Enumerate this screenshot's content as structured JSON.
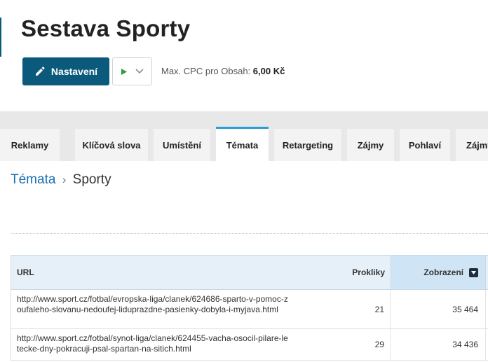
{
  "header": {
    "title": "Sestava Sporty",
    "settings_label": "Nastavení",
    "cpc_label": "Max. CPC pro Obsah:",
    "cpc_value": "6,00 Kč"
  },
  "tabs": [
    {
      "label": "Reklamy",
      "active": false
    },
    {
      "label": "Klíčová slova",
      "active": false
    },
    {
      "label": "Umístění",
      "active": false
    },
    {
      "label": "Témata",
      "active": true
    },
    {
      "label": "Retargeting",
      "active": false
    },
    {
      "label": "Zájmy",
      "active": false
    },
    {
      "label": "Pohlaví",
      "active": false
    },
    {
      "label": "Zájmy",
      "active": false
    }
  ],
  "breadcrumb": {
    "parent": "Témata",
    "separator": "›",
    "current": "Sporty"
  },
  "table": {
    "columns": {
      "url": "URL",
      "prokliky": "Prokliky",
      "zobrazeni": "Zobrazení"
    },
    "rows": [
      {
        "url": "http://www.sport.cz/fotbal/evropska-liga/clanek/624686-sparto-v-pomoc-zoufaleho-slovanu-nedoufej-liduprazdne-pasienky-dobyla-i-myjava.html",
        "prokliky": "21",
        "zobrazeni": "35 464"
      },
      {
        "url": "http://www.sport.cz/fotbal/synot-liga/clanek/624455-vacha-osocil-pilare-letecke-dny-pokracuji-psal-spartan-na-sitich.html",
        "prokliky": "29",
        "zobrazeni": "34 436"
      }
    ]
  },
  "colors": {
    "primary": "#0b5a7c",
    "link": "#1a6fae",
    "tab_active_border": "#2a9fd6",
    "play_green": "#2e9e3e"
  }
}
